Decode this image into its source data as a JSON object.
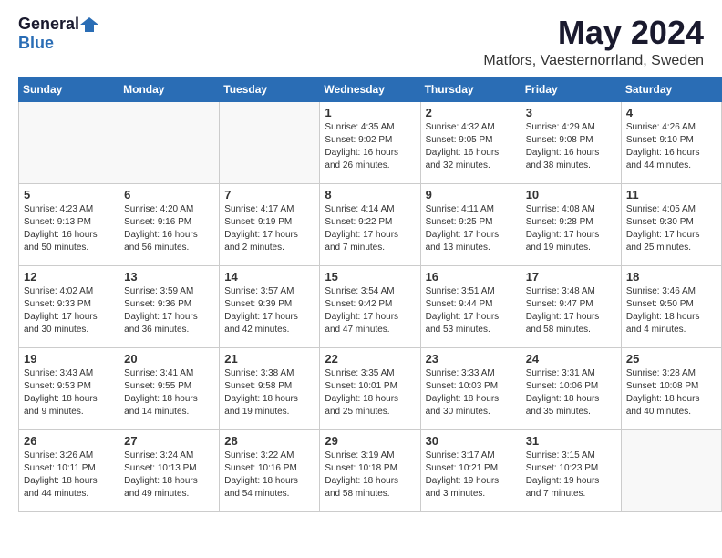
{
  "header": {
    "logo_general": "General",
    "logo_blue": "Blue",
    "title": "May 2024",
    "location": "Matfors, Vaesternorrland, Sweden"
  },
  "days_of_week": [
    "Sunday",
    "Monday",
    "Tuesday",
    "Wednesday",
    "Thursday",
    "Friday",
    "Saturday"
  ],
  "weeks": [
    [
      {
        "day": "",
        "info": "",
        "empty": true
      },
      {
        "day": "",
        "info": "",
        "empty": true
      },
      {
        "day": "",
        "info": "",
        "empty": true
      },
      {
        "day": "1",
        "info": "Sunrise: 4:35 AM\nSunset: 9:02 PM\nDaylight: 16 hours\nand 26 minutes."
      },
      {
        "day": "2",
        "info": "Sunrise: 4:32 AM\nSunset: 9:05 PM\nDaylight: 16 hours\nand 32 minutes."
      },
      {
        "day": "3",
        "info": "Sunrise: 4:29 AM\nSunset: 9:08 PM\nDaylight: 16 hours\nand 38 minutes."
      },
      {
        "day": "4",
        "info": "Sunrise: 4:26 AM\nSunset: 9:10 PM\nDaylight: 16 hours\nand 44 minutes."
      }
    ],
    [
      {
        "day": "5",
        "info": "Sunrise: 4:23 AM\nSunset: 9:13 PM\nDaylight: 16 hours\nand 50 minutes."
      },
      {
        "day": "6",
        "info": "Sunrise: 4:20 AM\nSunset: 9:16 PM\nDaylight: 16 hours\nand 56 minutes."
      },
      {
        "day": "7",
        "info": "Sunrise: 4:17 AM\nSunset: 9:19 PM\nDaylight: 17 hours\nand 2 minutes."
      },
      {
        "day": "8",
        "info": "Sunrise: 4:14 AM\nSunset: 9:22 PM\nDaylight: 17 hours\nand 7 minutes."
      },
      {
        "day": "9",
        "info": "Sunrise: 4:11 AM\nSunset: 9:25 PM\nDaylight: 17 hours\nand 13 minutes."
      },
      {
        "day": "10",
        "info": "Sunrise: 4:08 AM\nSunset: 9:28 PM\nDaylight: 17 hours\nand 19 minutes."
      },
      {
        "day": "11",
        "info": "Sunrise: 4:05 AM\nSunset: 9:30 PM\nDaylight: 17 hours\nand 25 minutes."
      }
    ],
    [
      {
        "day": "12",
        "info": "Sunrise: 4:02 AM\nSunset: 9:33 PM\nDaylight: 17 hours\nand 30 minutes."
      },
      {
        "day": "13",
        "info": "Sunrise: 3:59 AM\nSunset: 9:36 PM\nDaylight: 17 hours\nand 36 minutes."
      },
      {
        "day": "14",
        "info": "Sunrise: 3:57 AM\nSunset: 9:39 PM\nDaylight: 17 hours\nand 42 minutes."
      },
      {
        "day": "15",
        "info": "Sunrise: 3:54 AM\nSunset: 9:42 PM\nDaylight: 17 hours\nand 47 minutes."
      },
      {
        "day": "16",
        "info": "Sunrise: 3:51 AM\nSunset: 9:44 PM\nDaylight: 17 hours\nand 53 minutes."
      },
      {
        "day": "17",
        "info": "Sunrise: 3:48 AM\nSunset: 9:47 PM\nDaylight: 17 hours\nand 58 minutes."
      },
      {
        "day": "18",
        "info": "Sunrise: 3:46 AM\nSunset: 9:50 PM\nDaylight: 18 hours\nand 4 minutes."
      }
    ],
    [
      {
        "day": "19",
        "info": "Sunrise: 3:43 AM\nSunset: 9:53 PM\nDaylight: 18 hours\nand 9 minutes."
      },
      {
        "day": "20",
        "info": "Sunrise: 3:41 AM\nSunset: 9:55 PM\nDaylight: 18 hours\nand 14 minutes."
      },
      {
        "day": "21",
        "info": "Sunrise: 3:38 AM\nSunset: 9:58 PM\nDaylight: 18 hours\nand 19 minutes."
      },
      {
        "day": "22",
        "info": "Sunrise: 3:35 AM\nSunset: 10:01 PM\nDaylight: 18 hours\nand 25 minutes."
      },
      {
        "day": "23",
        "info": "Sunrise: 3:33 AM\nSunset: 10:03 PM\nDaylight: 18 hours\nand 30 minutes."
      },
      {
        "day": "24",
        "info": "Sunrise: 3:31 AM\nSunset: 10:06 PM\nDaylight: 18 hours\nand 35 minutes."
      },
      {
        "day": "25",
        "info": "Sunrise: 3:28 AM\nSunset: 10:08 PM\nDaylight: 18 hours\nand 40 minutes."
      }
    ],
    [
      {
        "day": "26",
        "info": "Sunrise: 3:26 AM\nSunset: 10:11 PM\nDaylight: 18 hours\nand 44 minutes."
      },
      {
        "day": "27",
        "info": "Sunrise: 3:24 AM\nSunset: 10:13 PM\nDaylight: 18 hours\nand 49 minutes."
      },
      {
        "day": "28",
        "info": "Sunrise: 3:22 AM\nSunset: 10:16 PM\nDaylight: 18 hours\nand 54 minutes."
      },
      {
        "day": "29",
        "info": "Sunrise: 3:19 AM\nSunset: 10:18 PM\nDaylight: 18 hours\nand 58 minutes."
      },
      {
        "day": "30",
        "info": "Sunrise: 3:17 AM\nSunset: 10:21 PM\nDaylight: 19 hours\nand 3 minutes."
      },
      {
        "day": "31",
        "info": "Sunrise: 3:15 AM\nSunset: 10:23 PM\nDaylight: 19 hours\nand 7 minutes."
      },
      {
        "day": "",
        "info": "",
        "empty": true
      }
    ]
  ]
}
